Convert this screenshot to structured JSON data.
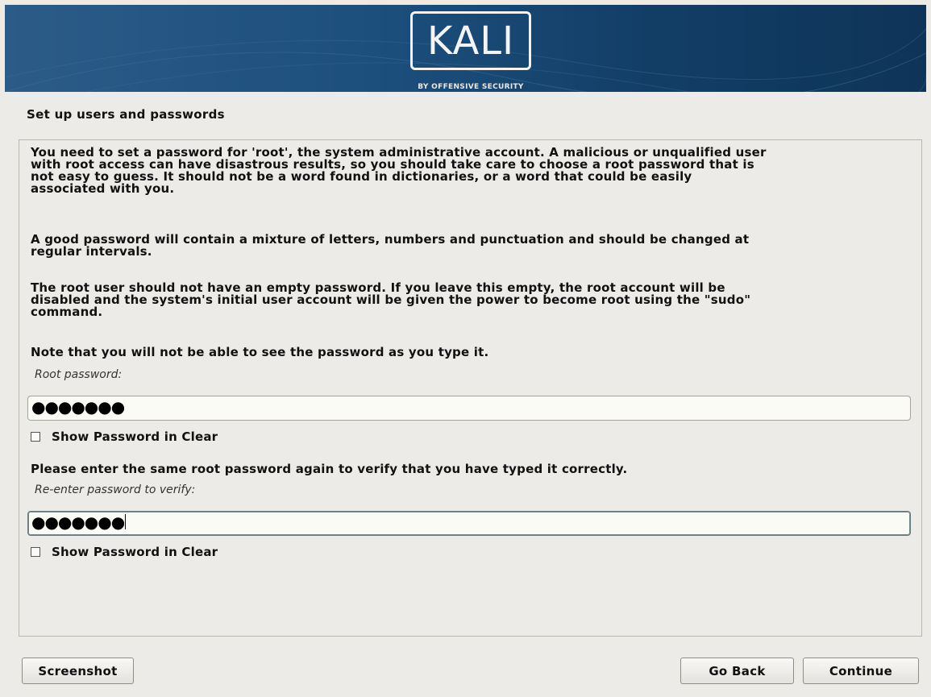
{
  "header": {
    "logo_text": "KALI",
    "logo_subtitle": "BY OFFENSIVE SECURITY",
    "colors": {
      "banner": "#1d4f7d",
      "banner_dark": "#0f3458"
    }
  },
  "page_title": "Set up users and passwords",
  "content": {
    "paragraph_1": "You need to set a password for 'root', the system administrative account. A malicious or unqualified user\nwith root access can have disastrous results, so you should take care to choose a root password that is\nnot easy to guess. It should not be a word found in dictionaries, or a word that could be easily\nassociated with you.",
    "paragraph_2": "A good password will contain a mixture of letters, numbers and punctuation and should be changed at\nregular intervals.",
    "paragraph_3": "The root user should not have an empty password. If you leave this empty, the root account will be\ndisabled and the system's initial user account will be given the power to become root using the \"sudo\"\ncommand.",
    "note": "Note that you will not be able to see the password as you type it.",
    "root_password": {
      "label": "Root password:",
      "masked_value": "●●●●●●●",
      "show_clear_label": "Show Password in Clear",
      "show_clear_checked": false
    },
    "verify_prompt": "Please enter the same root password again to verify that you have typed it correctly.",
    "verify_password": {
      "label": "Re-enter password to verify:",
      "masked_value": "●●●●●●●",
      "show_clear_label": "Show Password in Clear",
      "show_clear_checked": false
    }
  },
  "buttons": {
    "screenshot": "Screenshot",
    "go_back": "Go Back",
    "continue": "Continue"
  }
}
